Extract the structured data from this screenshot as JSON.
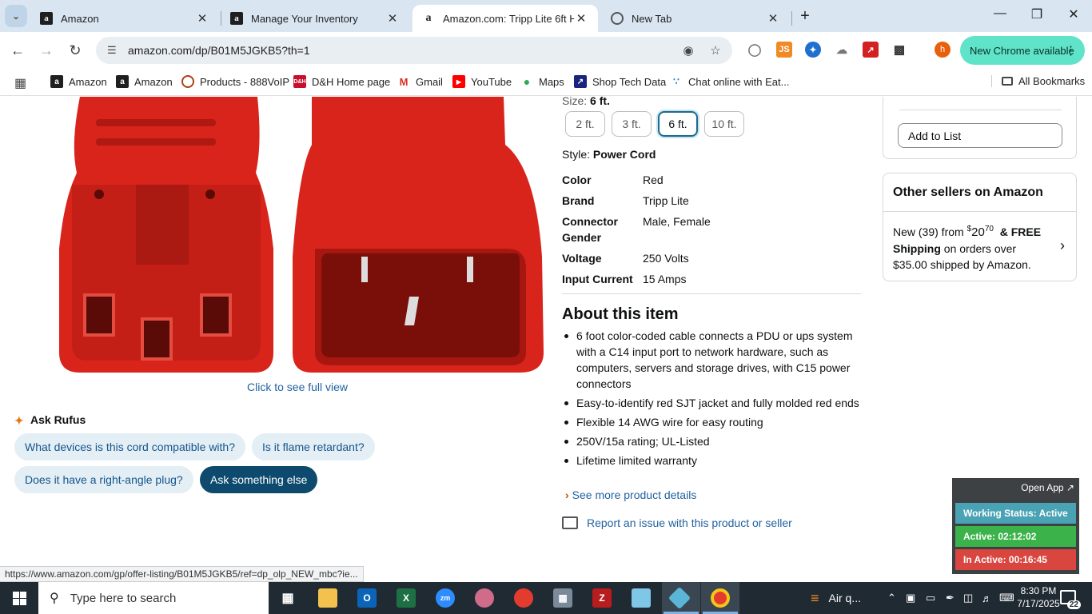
{
  "browser": {
    "tabs": [
      {
        "title": "Amazon",
        "favicon": "amazon-favicon"
      },
      {
        "title": "Manage Your Inventory",
        "favicon": "amazon-favicon"
      },
      {
        "title": "Amazon.com: Tripp Lite 6ft Hea",
        "favicon": "amazon-smile-favicon"
      },
      {
        "title": "New Tab",
        "favicon": "chrome-favicon"
      }
    ],
    "url": "amazon.com/dp/B01M5JGKB5?th=1",
    "update_label": "New Chrome available",
    "profile_initial": "h",
    "bookmarks": [
      {
        "label": "Amazon"
      },
      {
        "label": "Amazon"
      },
      {
        "label": "Products - 888VoIP"
      },
      {
        "label": "D&H Home page"
      },
      {
        "label": "Gmail"
      },
      {
        "label": "YouTube"
      },
      {
        "label": "Maps"
      },
      {
        "label": "Shop Tech Data"
      },
      {
        "label": "Chat online with Eat..."
      }
    ],
    "all_bookmarks": "All Bookmarks",
    "status_url": "https://www.amazon.com/gp/offer-listing/B01M5JGKB5/ref=dp_olp_NEW_mbc?ie..."
  },
  "product": {
    "full_view_link": "Click to see full view",
    "size_label": "Size:",
    "size_value": "6 ft.",
    "sizes": [
      "2 ft.",
      "3 ft.",
      "6 ft.",
      "10 ft."
    ],
    "selected_size": "6 ft.",
    "style_label": "Style:",
    "style_value": "Power Cord",
    "specs": [
      {
        "key": "Color",
        "value": "Red"
      },
      {
        "key": "Brand",
        "value": "Tripp Lite"
      },
      {
        "key": "Connector Gender",
        "value": "Male, Female"
      },
      {
        "key": "Voltage",
        "value": "250 Volts"
      },
      {
        "key": "Input Current",
        "value": "15 Amps"
      }
    ],
    "about_title": "About this item",
    "about_bullets": [
      "6 foot color-coded cable connects a PDU or ups system with a C14 input port to network hardware, such as computers, servers and storage drives, with C15 power connectors",
      "Easy-to-identify red SJT jacket and fully molded red ends",
      "Flexible 14 AWG wire for easy routing",
      "250V/15a rating; UL-Listed",
      "Lifetime limited warranty"
    ],
    "see_more": "See more product details",
    "report_issue": "Report an issue with this product or seller",
    "product_color": "#d9241c"
  },
  "rufus": {
    "title": "Ask Rufus",
    "chips": [
      "What devices is this cord compatible with?",
      "Is it flame retardant?",
      "Does it have a right-angle plug?",
      "Ask something else"
    ]
  },
  "buybox": {
    "add_to_list": "Add to List"
  },
  "other_sellers": {
    "title": "Other sellers on Amazon",
    "new_count": "New (39) from",
    "price_dollars": "20",
    "price_cents": "70",
    "free": "& FREE",
    "shipping": "Shipping",
    "shipping_rest": "on orders over $35.00 shipped by Amazon."
  },
  "tracker": {
    "open_app": "Open App ↗",
    "working_status": "Working Status: Active",
    "active": "Active: 02:12:02",
    "inactive": "In Active: 00:16:45",
    "colors": {
      "status": "#4aa3b5",
      "active": "#3cb34a",
      "inactive": "#d9463f"
    }
  },
  "taskbar": {
    "search_placeholder": "Type here to search",
    "weather": "Air q...",
    "time": "8:30 PM",
    "date": "7/17/2025",
    "notifications": "22"
  }
}
